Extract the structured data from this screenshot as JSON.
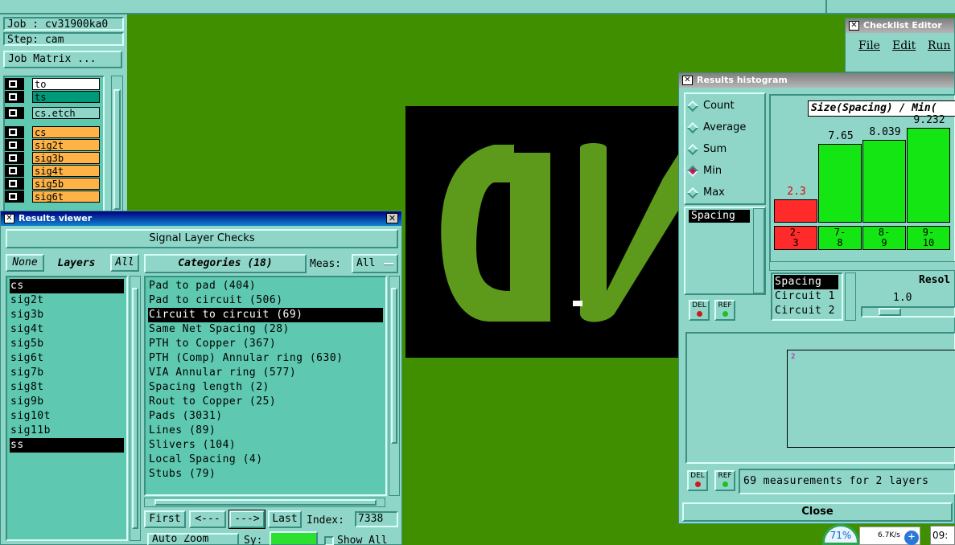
{
  "job_panel": {
    "job": "Job : cv31900ka0",
    "step": "Step: cam",
    "matrix_button": "Job Matrix ...",
    "layers": [
      {
        "name": "to",
        "color": "#ffffff"
      },
      {
        "name": "ts",
        "color": "#00997a"
      },
      {
        "name": "cs.etch",
        "color": "#8fd6c8"
      },
      {
        "name": "cs",
        "color": "#ffb347"
      },
      {
        "name": "sig2t",
        "color": "#ffb347"
      },
      {
        "name": "sig3b",
        "color": "#ffb347"
      },
      {
        "name": "sig4t",
        "color": "#ffb347"
      },
      {
        "name": "sig5b",
        "color": "#ffb347"
      },
      {
        "name": "sig6t",
        "color": "#ffb347"
      }
    ]
  },
  "results_viewer": {
    "title": "Results viewer",
    "header_button": "Signal Layer Checks",
    "none_button": "None",
    "layers_label": "Layers",
    "all_button": "All",
    "categories_label": "Categories (18)",
    "meas_label": "Meas:",
    "meas_value": "All",
    "layers": [
      {
        "name": "cs",
        "selected": true
      },
      {
        "name": "sig2t",
        "selected": false
      },
      {
        "name": "sig3b",
        "selected": false
      },
      {
        "name": "sig4t",
        "selected": false
      },
      {
        "name": "sig5b",
        "selected": false
      },
      {
        "name": "sig6t",
        "selected": false
      },
      {
        "name": "sig7b",
        "selected": false
      },
      {
        "name": "sig8t",
        "selected": false
      },
      {
        "name": "sig9b",
        "selected": false
      },
      {
        "name": "sig10t",
        "selected": false
      },
      {
        "name": "sig11b",
        "selected": false
      },
      {
        "name": "ss",
        "selected": true
      }
    ],
    "categories": [
      {
        "name": "Pad to pad (404)",
        "selected": false
      },
      {
        "name": "Pad to circuit (506)",
        "selected": false
      },
      {
        "name": "Circuit to circuit (69)",
        "selected": true
      },
      {
        "name": "Same Net Spacing (28)",
        "selected": false
      },
      {
        "name": "PTH to Copper (367)",
        "selected": false
      },
      {
        "name": "PTH (Comp) Annular ring (630)",
        "selected": false
      },
      {
        "name": "VIA Annular ring (577)",
        "selected": false
      },
      {
        "name": "Spacing length (2)",
        "selected": false
      },
      {
        "name": "Rout to Copper (25)",
        "selected": false
      },
      {
        "name": "Pads (3031)",
        "selected": false
      },
      {
        "name": "Lines (89)",
        "selected": false
      },
      {
        "name": "Slivers (104)",
        "selected": false
      },
      {
        "name": "Local Spacing (4)",
        "selected": false
      },
      {
        "name": "Stubs (79)",
        "selected": false
      }
    ],
    "nav": {
      "first": "First",
      "prev": "<---",
      "next": "--->",
      "last": "Last",
      "index_label": "Index:",
      "index_value": "7338"
    },
    "zoom_label": "Auto Zoom",
    "sy_label": "Sy:",
    "show_all_label": "Show All"
  },
  "histogram": {
    "title": "Results histogram",
    "modes": [
      {
        "label": "Count",
        "selected": false
      },
      {
        "label": "Average",
        "selected": false
      },
      {
        "label": "Sum",
        "selected": false
      },
      {
        "label": "Min",
        "selected": true
      },
      {
        "label": "Max",
        "selected": false
      }
    ],
    "chart_title": "Size(Spacing) / Min(",
    "measure_list": [
      "Spacing"
    ],
    "bins": [
      {
        "label": "2-\n3",
        "value": "2.3",
        "color": "#ff2a2a"
      },
      {
        "label": "7-\n8",
        "value": "7.65",
        "color": "#14e614"
      },
      {
        "label": "8-\n9",
        "value": "8.039",
        "color": "#14e614"
      },
      {
        "label": "9-\n10",
        "value": "9.232",
        "color": "#14e614"
      }
    ],
    "legend_items": [
      {
        "label": "Spacing",
        "selected": true
      },
      {
        "label": "Circuit 1",
        "selected": false
      },
      {
        "label": "Circuit 2",
        "selected": false
      }
    ],
    "resolution_label": "Resol",
    "resolution_value": "1.0",
    "del_label": "DEL",
    "ref_label": "REF",
    "mini_marker": "2",
    "status": "69 measurements for 2 layers",
    "close_button": "Close"
  },
  "checklist_editor": {
    "title": "Checklist Editor",
    "menus": [
      "File",
      "Edit",
      "Run"
    ]
  },
  "taskbar": {
    "cpu": "71%",
    "net": "6.7K/s",
    "clock": "09:"
  }
}
